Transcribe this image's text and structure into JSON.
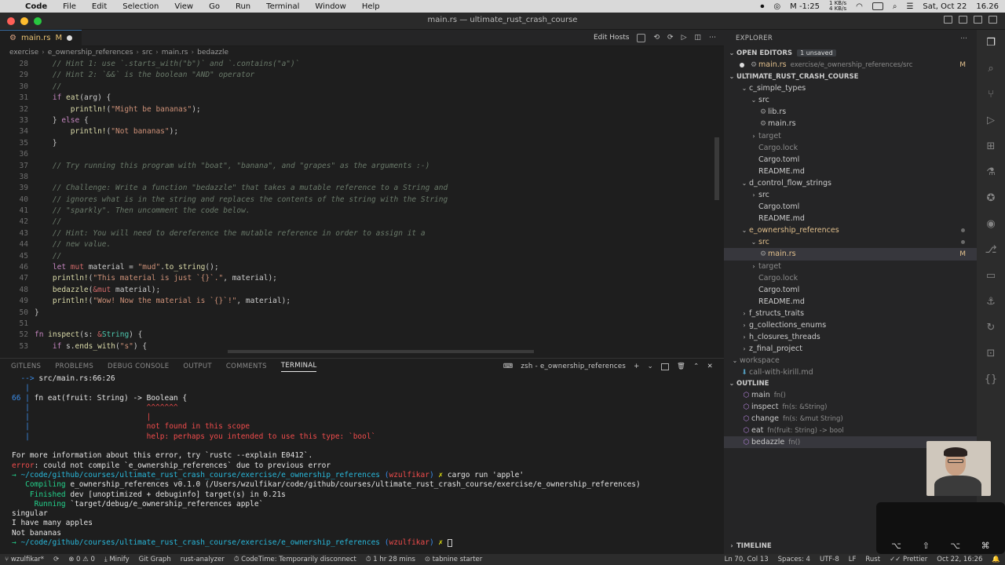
{
  "menubar": {
    "app": "Code",
    "items": [
      "File",
      "Edit",
      "Selection",
      "View",
      "Go",
      "Run",
      "Terminal",
      "Window",
      "Help"
    ],
    "net_up": "1 KB/s",
    "net_down": "4 KB/s",
    "status_time": "M -1:25",
    "date": "Sat, Oct 22",
    "time": "16.26"
  },
  "window": {
    "title": "main.rs — ultimate_rust_crash_course"
  },
  "editor": {
    "tab_label": "main.rs",
    "tab_flag": "M",
    "actions_label": "Edit Hosts",
    "breadcrumb": [
      "exercise",
      "e_ownership_references",
      "src",
      "main.rs",
      "bedazzle"
    ],
    "lines": [
      {
        "n": "28",
        "segs": [
          {
            "c": "cm",
            "t": "    // Hint 1: use `.starts_with(\"b\")` and `.contains(\"a\")`"
          }
        ]
      },
      {
        "n": "29",
        "segs": [
          {
            "c": "cm",
            "t": "    // Hint 2: `&&` is the boolean \"AND\" operator"
          }
        ]
      },
      {
        "n": "30",
        "segs": [
          {
            "c": "cm",
            "t": "    //"
          }
        ]
      },
      {
        "n": "31",
        "segs": [
          {
            "c": "kw",
            "t": "    if "
          },
          {
            "c": "fn",
            "t": "eat"
          },
          {
            "c": "id",
            "t": "(arg) {"
          }
        ]
      },
      {
        "n": "32",
        "segs": [
          {
            "c": "mac",
            "t": "        println!"
          },
          {
            "c": "id",
            "t": "("
          },
          {
            "c": "str",
            "t": "\"Might be bananas\""
          },
          {
            "c": "id",
            "t": ");"
          }
        ]
      },
      {
        "n": "33",
        "segs": [
          {
            "c": "id",
            "t": "    } "
          },
          {
            "c": "kw",
            "t": "else"
          },
          {
            "c": "id",
            "t": " {"
          }
        ]
      },
      {
        "n": "34",
        "segs": [
          {
            "c": "mac",
            "t": "        println!"
          },
          {
            "c": "id",
            "t": "("
          },
          {
            "c": "str",
            "t": "\"Not bananas\""
          },
          {
            "c": "id",
            "t": ");"
          }
        ]
      },
      {
        "n": "35",
        "segs": [
          {
            "c": "id",
            "t": "    }"
          }
        ]
      },
      {
        "n": "36",
        "segs": [
          {
            "c": "id",
            "t": ""
          }
        ]
      },
      {
        "n": "37",
        "segs": [
          {
            "c": "cm",
            "t": "    // Try running this program with \"boat\", \"banana\", and \"grapes\" as the arguments :-)"
          }
        ]
      },
      {
        "n": "38",
        "segs": [
          {
            "c": "id",
            "t": ""
          }
        ]
      },
      {
        "n": "39",
        "segs": [
          {
            "c": "cm",
            "t": "    // Challenge: Write a function \"bedazzle\" that takes a mutable reference to a String and"
          }
        ]
      },
      {
        "n": "40",
        "segs": [
          {
            "c": "cm",
            "t": "    // ignores what is in the string and replaces the contents of the string with the String"
          }
        ]
      },
      {
        "n": "41",
        "segs": [
          {
            "c": "cm",
            "t": "    // \"sparkly\". Then uncomment the code below."
          }
        ]
      },
      {
        "n": "42",
        "segs": [
          {
            "c": "cm",
            "t": "    //"
          }
        ]
      },
      {
        "n": "43",
        "segs": [
          {
            "c": "cm",
            "t": "    // Hint: You will need to dereference the mutable reference in order to assign it a"
          }
        ]
      },
      {
        "n": "44",
        "segs": [
          {
            "c": "cm",
            "t": "    // new value."
          }
        ]
      },
      {
        "n": "45",
        "segs": [
          {
            "c": "cm",
            "t": "    //"
          }
        ]
      },
      {
        "n": "46",
        "segs": [
          {
            "c": "kw",
            "t": "    let "
          },
          {
            "c": "kw2",
            "t": "mut "
          },
          {
            "c": "id",
            "t": "material = "
          },
          {
            "c": "str",
            "t": "\"mud\""
          },
          {
            "c": "id",
            "t": "."
          },
          {
            "c": "fn",
            "t": "to_string"
          },
          {
            "c": "id",
            "t": "();"
          }
        ]
      },
      {
        "n": "47",
        "segs": [
          {
            "c": "mac",
            "t": "    println!"
          },
          {
            "c": "id",
            "t": "("
          },
          {
            "c": "str",
            "t": "\"This material is just `{}`.\""
          },
          {
            "c": "id",
            "t": ", material);"
          }
        ]
      },
      {
        "n": "48",
        "segs": [
          {
            "c": "fn",
            "t": "    bedazzle"
          },
          {
            "c": "id",
            "t": "("
          },
          {
            "c": "kw2",
            "t": "&mut "
          },
          {
            "c": "id",
            "t": "material);"
          }
        ]
      },
      {
        "n": "49",
        "segs": [
          {
            "c": "mac",
            "t": "    println!"
          },
          {
            "c": "id",
            "t": "("
          },
          {
            "c": "str",
            "t": "\"Wow! Now the material is `{}`!\""
          },
          {
            "c": "id",
            "t": ", material);"
          }
        ]
      },
      {
        "n": "50",
        "segs": [
          {
            "c": "id",
            "t": "}"
          }
        ]
      },
      {
        "n": "51",
        "segs": [
          {
            "c": "id",
            "t": ""
          }
        ]
      },
      {
        "n": "52",
        "segs": [
          {
            "c": "kw",
            "t": "fn "
          },
          {
            "c": "fn",
            "t": "inspect"
          },
          {
            "c": "id",
            "t": "(s: "
          },
          {
            "c": "kw2",
            "t": "&"
          },
          {
            "c": "ty",
            "t": "String"
          },
          {
            "c": "id",
            "t": ") {"
          }
        ]
      },
      {
        "n": "53",
        "segs": [
          {
            "c": "kw",
            "t": "    if "
          },
          {
            "c": "id",
            "t": "s."
          },
          {
            "c": "fn",
            "t": "ends_with"
          },
          {
            "c": "id",
            "t": "("
          },
          {
            "c": "str",
            "t": "\"s\""
          },
          {
            "c": "id",
            "t": ") {"
          }
        ]
      }
    ]
  },
  "panel": {
    "tabs": [
      "GITLENS",
      "PROBLEMS",
      "DEBUG CONSOLE",
      "OUTPUT",
      "COMMENTS",
      "TERMINAL"
    ],
    "active_tab": "TERMINAL",
    "terminal_name": "zsh - e_ownership_references",
    "terminal_lines": [
      {
        "segs": [
          {
            "c": "blue",
            "t": "  --> "
          },
          {
            "c": "",
            "t": "src/main.rs:66:26"
          }
        ]
      },
      {
        "segs": [
          {
            "c": "blue",
            "t": "   |"
          }
        ]
      },
      {
        "segs": [
          {
            "c": "blue",
            "t": "66 |"
          },
          {
            "c": "",
            "t": " fn eat(fruit: String) -> Boolean {"
          }
        ]
      },
      {
        "segs": [
          {
            "c": "blue",
            "t": "   |"
          },
          {
            "c": "red",
            "t": "                          ^^^^^^^"
          }
        ]
      },
      {
        "segs": [
          {
            "c": "blue",
            "t": "   |"
          },
          {
            "c": "red",
            "t": "                          |"
          }
        ]
      },
      {
        "segs": [
          {
            "c": "blue",
            "t": "   |"
          },
          {
            "c": "red",
            "t": "                          not found in this scope"
          }
        ]
      },
      {
        "segs": [
          {
            "c": "blue",
            "t": "   |"
          },
          {
            "c": "red",
            "t": "                          help: perhaps you intended to use this type: `bool`"
          }
        ]
      },
      {
        "segs": [
          {
            "c": "",
            "t": ""
          }
        ]
      },
      {
        "segs": [
          {
            "c": "",
            "t": "For more information about this error, try `rustc --explain E0412`."
          }
        ]
      },
      {
        "segs": [
          {
            "c": "red",
            "t": "error"
          },
          {
            "c": "",
            "t": ": could not compile `e_ownership_references` due to previous error"
          }
        ]
      },
      {
        "segs": [
          {
            "c": "green",
            "t": "→ "
          },
          {
            "c": "cyan",
            "t": "~/code/github/courses/ultimate_rust_crash_course/exercise/e_ownership_references "
          },
          {
            "c": "blue",
            "t": "("
          },
          {
            "c": "red",
            "t": "wzulfikar"
          },
          {
            "c": "blue",
            "t": ") "
          },
          {
            "c": "yellow",
            "t": "✗ "
          },
          {
            "c": "",
            "t": "cargo run 'apple'"
          }
        ]
      },
      {
        "segs": [
          {
            "c": "green",
            "t": "   Compiling "
          },
          {
            "c": "",
            "t": "e_ownership_references v0.1.0 (/Users/wzulfikar/code/github/courses/ultimate_rust_crash_course/exercise/e_ownership_references)"
          }
        ]
      },
      {
        "segs": [
          {
            "c": "green",
            "t": "    Finished "
          },
          {
            "c": "",
            "t": "dev [unoptimized + debuginfo] target(s) in 0.21s"
          }
        ]
      },
      {
        "segs": [
          {
            "c": "green",
            "t": "     Running "
          },
          {
            "c": "",
            "t": "`target/debug/e_ownership_references apple`"
          }
        ]
      },
      {
        "segs": [
          {
            "c": "",
            "t": "singular"
          }
        ]
      },
      {
        "segs": [
          {
            "c": "",
            "t": "I have many apples"
          }
        ]
      },
      {
        "segs": [
          {
            "c": "",
            "t": "Not bananas"
          }
        ]
      },
      {
        "segs": [
          {
            "c": "green",
            "t": "→ "
          },
          {
            "c": "cyan",
            "t": "~/code/github/courses/ultimate_rust_crash_course/exercise/e_ownership_references "
          },
          {
            "c": "blue",
            "t": "("
          },
          {
            "c": "red",
            "t": "wzulfikar"
          },
          {
            "c": "blue",
            "t": ") "
          },
          {
            "c": "yellow",
            "t": "✗ "
          }
        ]
      }
    ]
  },
  "explorer": {
    "header": "EXPLORER",
    "open_editors": "OPEN EDITORS",
    "unsaved_badge": "1 unsaved",
    "open_file": "main.rs",
    "open_file_path": "exercise/e_ownership_references/src",
    "open_file_flag": "M",
    "root": "ULTIMATE_RUST_CRASH_COURSE",
    "tree": [
      {
        "label": "c_simple_types",
        "indent": 1,
        "kind": "folder-open"
      },
      {
        "label": "src",
        "indent": 2,
        "kind": "folder-open"
      },
      {
        "label": "lib.rs",
        "indent": 3,
        "kind": "rs"
      },
      {
        "label": "main.rs",
        "indent": 3,
        "kind": "rs"
      },
      {
        "label": "target",
        "indent": 2,
        "kind": "folder-closed",
        "dim": true
      },
      {
        "label": "Cargo.lock",
        "indent": 2,
        "kind": "file",
        "dim": true
      },
      {
        "label": "Cargo.toml",
        "indent": 2,
        "kind": "gear"
      },
      {
        "label": "README.md",
        "indent": 2,
        "kind": "md"
      },
      {
        "label": "d_control_flow_strings",
        "indent": 1,
        "kind": "folder-open"
      },
      {
        "label": "src",
        "indent": 2,
        "kind": "folder-closed"
      },
      {
        "label": "Cargo.toml",
        "indent": 2,
        "kind": "gear"
      },
      {
        "label": "README.md",
        "indent": 2,
        "kind": "md"
      },
      {
        "label": "e_ownership_references",
        "indent": 1,
        "kind": "folder-open",
        "mod": true,
        "dot": true
      },
      {
        "label": "src",
        "indent": 2,
        "kind": "folder-open",
        "mod": true,
        "dot": true
      },
      {
        "label": "main.rs",
        "indent": 3,
        "kind": "rs",
        "mod": true,
        "selected": true,
        "flag": "M"
      },
      {
        "label": "target",
        "indent": 2,
        "kind": "folder-closed",
        "dim": true
      },
      {
        "label": "Cargo.lock",
        "indent": 2,
        "kind": "file",
        "dim": true
      },
      {
        "label": "Cargo.toml",
        "indent": 2,
        "kind": "gear"
      },
      {
        "label": "README.md",
        "indent": 2,
        "kind": "md"
      },
      {
        "label": "f_structs_traits",
        "indent": 1,
        "kind": "folder-closed"
      },
      {
        "label": "g_collections_enums",
        "indent": 1,
        "kind": "folder-closed"
      },
      {
        "label": "h_closures_threads",
        "indent": 1,
        "kind": "folder-closed"
      },
      {
        "label": "z_final_project",
        "indent": 1,
        "kind": "folder-closed"
      },
      {
        "label": "workspace",
        "indent": 0,
        "kind": "folder-open",
        "dim": true
      },
      {
        "label": "call-with-kirill.md",
        "indent": 1,
        "kind": "md",
        "dim": true
      }
    ],
    "outline_title": "OUTLINE",
    "outline": [
      {
        "name": "main",
        "sig": "fn()"
      },
      {
        "name": "inspect",
        "sig": "fn(s: &String)"
      },
      {
        "name": "change",
        "sig": "fn(s: &mut String)"
      },
      {
        "name": "eat",
        "sig": "fn(fruit: String) -> bool"
      },
      {
        "name": "bedazzle",
        "sig": "fn()",
        "selected": true
      }
    ],
    "timeline_title": "TIMELINE"
  },
  "statusbar": {
    "branch": "wzulfikar*",
    "problems": "⊗ 0 ⚠ 0",
    "minify": "Minify",
    "git_graph": "Git Graph",
    "analyzer": "rust-analyzer",
    "codetime": "CodeTime: Temporarily disconnect",
    "time_spent": "1 hr 28 mins",
    "tabnine": "tabnine starter",
    "position": "Ln 70, Col 13",
    "spaces": "Spaces: 4",
    "encoding": "UTF-8",
    "eol": "LF",
    "language": "Rust",
    "prettier": "Prettier",
    "datetime": "Oct 22, 16:26"
  }
}
